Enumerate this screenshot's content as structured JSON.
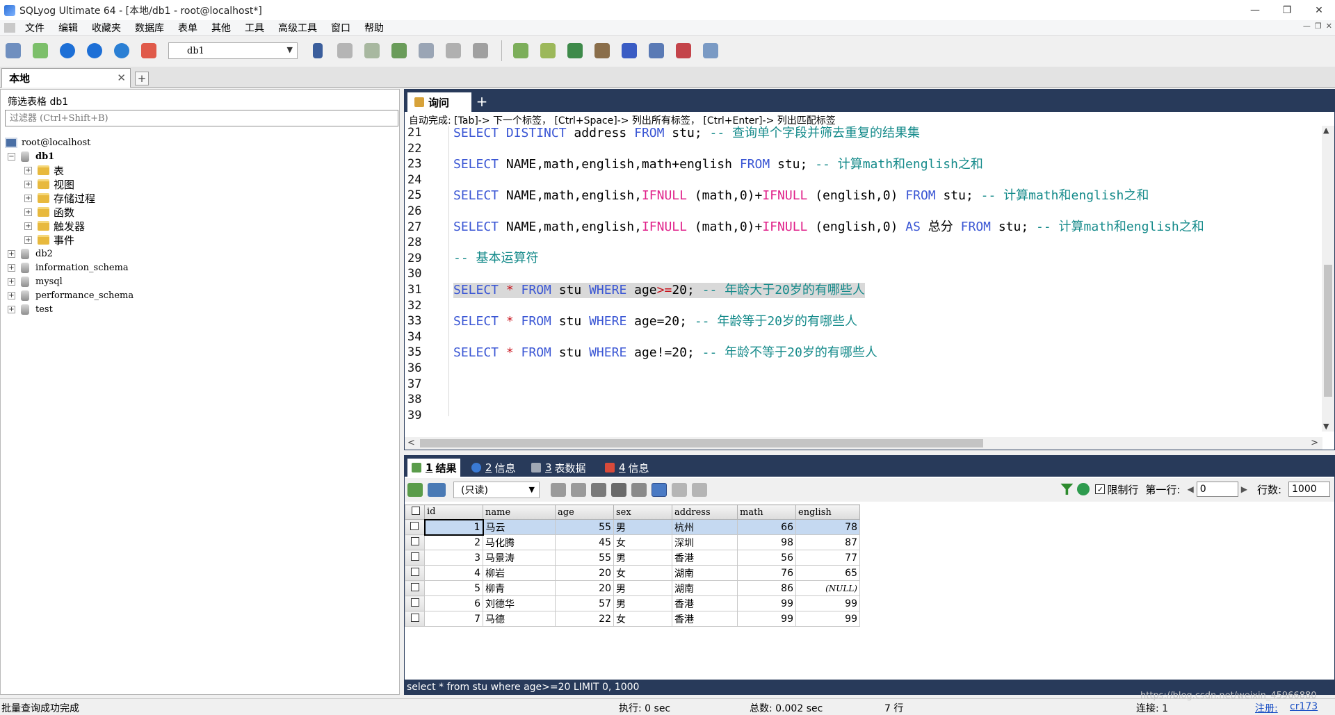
{
  "window": {
    "title": "SQLyog Ultimate 64 - [本地/db1 - root@localhost*]",
    "minimize": "—",
    "restore": "❐",
    "close": "✕"
  },
  "menu": [
    "文件",
    "编辑",
    "收藏夹",
    "数据库",
    "表单",
    "其他",
    "工具",
    "高级工具",
    "窗口",
    "帮助"
  ],
  "toolbar": {
    "db_select": "db1"
  },
  "object_tab": {
    "label": "本地",
    "close": "✕",
    "add": "+"
  },
  "left": {
    "filter_label": "筛选表格  db1",
    "filter_placeholder": "过滤器 (Ctrl+Shift+B)",
    "tree": {
      "server": "root@localhost",
      "db1": "db1",
      "db1_children": [
        "表",
        "视图",
        "存储过程",
        "函数",
        "触发器",
        "事件"
      ],
      "others": [
        "db2",
        "information_schema",
        "mysql",
        "performance_schema",
        "test"
      ]
    }
  },
  "editor": {
    "tab_label": "询问",
    "add": "+",
    "hint": "自动完成:  [Tab]-> 下一个标签， [Ctrl+Space]-> 列出所有标签， [Ctrl+Enter]-> 列出匹配标签",
    "line_numbers": [
      "21",
      "22",
      "23",
      "24",
      "25",
      "26",
      "27",
      "28",
      "29",
      "30",
      "31",
      "32",
      "33",
      "34",
      "35",
      "36",
      "37",
      "38",
      "39"
    ],
    "code": {
      "l21": {
        "a": "SELECT DISTINCT",
        "b": " address ",
        "c": "FROM",
        "d": " stu; ",
        "e": "-- 查询单个字段并筛去重复的结果集"
      },
      "l23": {
        "a": "SELECT",
        "b": " NAME,math,english,math+english ",
        "c": "FROM",
        "d": " stu; ",
        "e": "-- 计算math和english之和"
      },
      "l25": {
        "a": "SELECT",
        "b": " NAME,math,english,",
        "f1": "IFNULL",
        "g": " (math,0)+",
        "f2": "IFNULL",
        "h": " (english,0) ",
        "c": "FROM",
        "d": " stu; ",
        "e": "-- 计算math和english之和"
      },
      "l27": {
        "a": "SELECT",
        "b": " NAME,math,english,",
        "f1": "IFNULL",
        "g": " (math,0)+",
        "f2": "IFNULL",
        "h": " (english,0) ",
        "as": "AS",
        "alias": " 总分 ",
        "c": "FROM",
        "d": " stu; ",
        "e": "-- 计算math和english之和"
      },
      "l29": {
        "e": "-- 基本运算符"
      },
      "l31": {
        "a": "SELECT",
        "star": " * ",
        "c": "FROM",
        "d": " stu ",
        "w": "WHERE",
        "cond": " age",
        "op": ">=",
        "val": "20; ",
        "e": "-- 年龄大于20岁的有哪些人"
      },
      "l33": {
        "a": "SELECT",
        "star": " * ",
        "c": "FROM",
        "d": " stu ",
        "w": "WHERE",
        "cond": " age=20; ",
        "e": "-- 年龄等于20岁的有哪些人"
      },
      "l35": {
        "a": "SELECT",
        "star": " * ",
        "c": "FROM",
        "d": " stu ",
        "w": "WHERE",
        "cond": " age!=20; ",
        "e": "-- 年龄不等于20岁的有哪些人"
      }
    }
  },
  "results": {
    "tabs": [
      {
        "num": "1",
        "label": "结果"
      },
      {
        "num": "2",
        "label": "信息"
      },
      {
        "num": "3",
        "label": "表数据"
      },
      {
        "num": "4",
        "label": "信息"
      }
    ],
    "mode_select": "(只读)",
    "limit_label": "限制行",
    "first_row_label": "第一行:",
    "first_row_value": "0",
    "rows_label": "行数:",
    "rows_value": "1000",
    "columns": [
      "id",
      "name",
      "age",
      "sex",
      "address",
      "math",
      "english"
    ],
    "rows": [
      [
        "1",
        "马云",
        "55",
        "男",
        "杭州",
        "66",
        "78"
      ],
      [
        "2",
        "马化腾",
        "45",
        "女",
        "深圳",
        "98",
        "87"
      ],
      [
        "3",
        "马景涛",
        "55",
        "男",
        "香港",
        "56",
        "77"
      ],
      [
        "4",
        "柳岩",
        "20",
        "女",
        "湖南",
        "76",
        "65"
      ],
      [
        "5",
        "柳青",
        "20",
        "男",
        "湖南",
        "86",
        "(NULL)"
      ],
      [
        "6",
        "刘德华",
        "57",
        "男",
        "香港",
        "99",
        "99"
      ],
      [
        "7",
        "马德",
        "22",
        "女",
        "香港",
        "99",
        "99"
      ]
    ]
  },
  "sql_status": "select * from stu where age>=20 LIMIT 0, 1000",
  "status": {
    "left": "批量查询成功完成",
    "exec": "执行: 0 sec",
    "total": "总数: 0.002 sec",
    "rows": "7 行",
    "conn": "连接: 1",
    "reg": "注册:",
    "user": "cr173",
    "watermark": "https://blog.csdn.net/weixin_45966880"
  }
}
